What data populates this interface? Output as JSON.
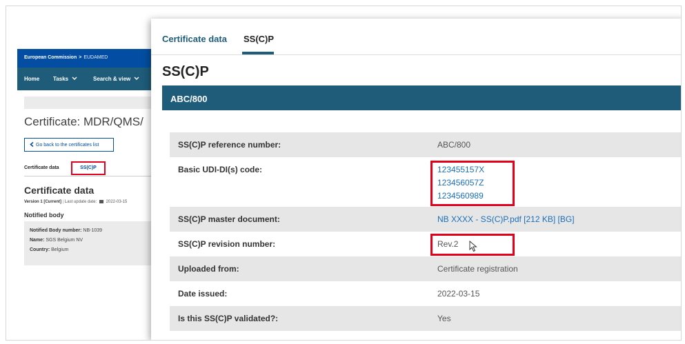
{
  "background_page": {
    "breadcrumb": [
      "European Commission",
      "EUDAMED"
    ],
    "breadcrumb_sep": ">",
    "nav": [
      "Home",
      "Tasks",
      "Search & view"
    ],
    "title": "Certificate: MDR/QMS/",
    "back_button": "Go back to the certificates list",
    "tabs": {
      "data": "Certificate data",
      "sscp": "SS(C)P"
    },
    "section_title": "Certificate data",
    "version": {
      "label": "Version 1 [Current]",
      "update_label": "Last update date:",
      "update_date": "2022-03-15"
    },
    "notified_body": {
      "heading": "Notified body",
      "number_label": "Notified Body number:",
      "number_value": "NB-1039",
      "name_label": "Name:",
      "name_value": "SGS Belgium NV",
      "country_label": "Country:",
      "country_value": "Belgium"
    }
  },
  "panel": {
    "tabs": {
      "data": "Certificate data",
      "sscp": "SS(C)P"
    },
    "title": "SS(C)P",
    "header": "ABC/800",
    "rows": {
      "reference": {
        "label": "SS(C)P reference number:",
        "value": "ABC/800"
      },
      "udi": {
        "label": "Basic UDI-DI(s) code:",
        "values": [
          "123455157X",
          "123456057Z",
          "1234560989"
        ]
      },
      "master": {
        "label": "SS(C)P master document:",
        "value": "NB XXXX - SS(C)P.pdf [212 KB] [BG]"
      },
      "revision": {
        "label": "SS(C)P revision number:",
        "value": "Rev.2"
      },
      "uploaded": {
        "label": "Uploaded from:",
        "value": "Certificate registration"
      },
      "issued": {
        "label": "Date issued:",
        "value": "2022-03-15"
      },
      "validated": {
        "label": "Is this SS(C)P validated?:",
        "value": "Yes"
      }
    }
  },
  "colors": {
    "accent": "#1e5c7a",
    "brand": "#034ea2",
    "highlight": "#e3001b",
    "link": "#1a6fb8"
  },
  "icons": [
    "chevron-down-icon",
    "chevron-left-icon",
    "calendar-icon",
    "mouse-cursor-icon"
  ]
}
